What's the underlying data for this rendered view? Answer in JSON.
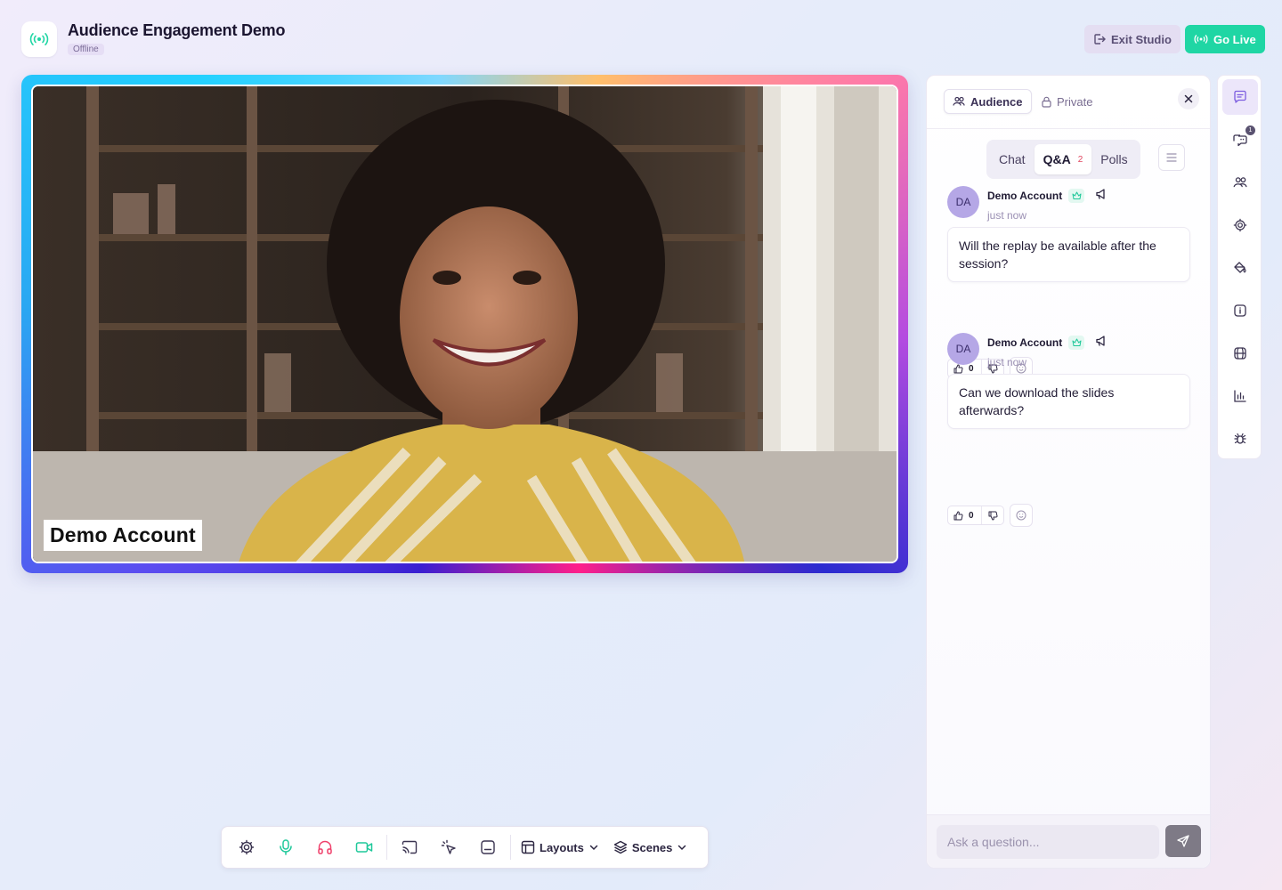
{
  "header": {
    "title": "Audience Engagement Demo",
    "status": "Offline",
    "exit_label": "Exit Studio",
    "golive_label": "Go Live"
  },
  "stage": {
    "participant_name": "Demo Account"
  },
  "toolbar": {
    "layouts_label": "Layouts",
    "scenes_label": "Scenes",
    "icons": [
      "gear-icon",
      "microphone-icon",
      "headphones-icon",
      "camera-icon",
      "cast-icon",
      "pointer-icon",
      "caption-icon"
    ]
  },
  "panel": {
    "tabs": [
      {
        "label": "Audience",
        "icon": "people-icon",
        "active": true
      },
      {
        "label": "Private",
        "icon": "lock-icon",
        "active": false
      }
    ],
    "segments": [
      {
        "label": "Chat",
        "active": false
      },
      {
        "label": "Q&A",
        "active": true,
        "count": "2"
      },
      {
        "label": "Polls",
        "active": false
      }
    ],
    "questions": [
      {
        "initials": "DA",
        "name": "Demo Account",
        "time": "just now",
        "text": "Will the replay be available after the session?",
        "upvotes": "0"
      },
      {
        "initials": "DA",
        "name": "Demo Account",
        "time": "just now",
        "text": "Can we download the slides afterwards?",
        "upvotes": "0"
      }
    ],
    "ask_placeholder": "Ask a question..."
  },
  "rail": {
    "items": [
      "chat-icon",
      "qa-icon",
      "people-icon",
      "settings-icon",
      "paint-bucket-icon",
      "info-icon",
      "globe-icon",
      "bar-chart-icon",
      "bug-icon"
    ],
    "badge": "1"
  },
  "colors": {
    "accent_green": "#1fd6a4",
    "accent_purple": "#ece6fa",
    "badge_red": "#e0455f"
  }
}
